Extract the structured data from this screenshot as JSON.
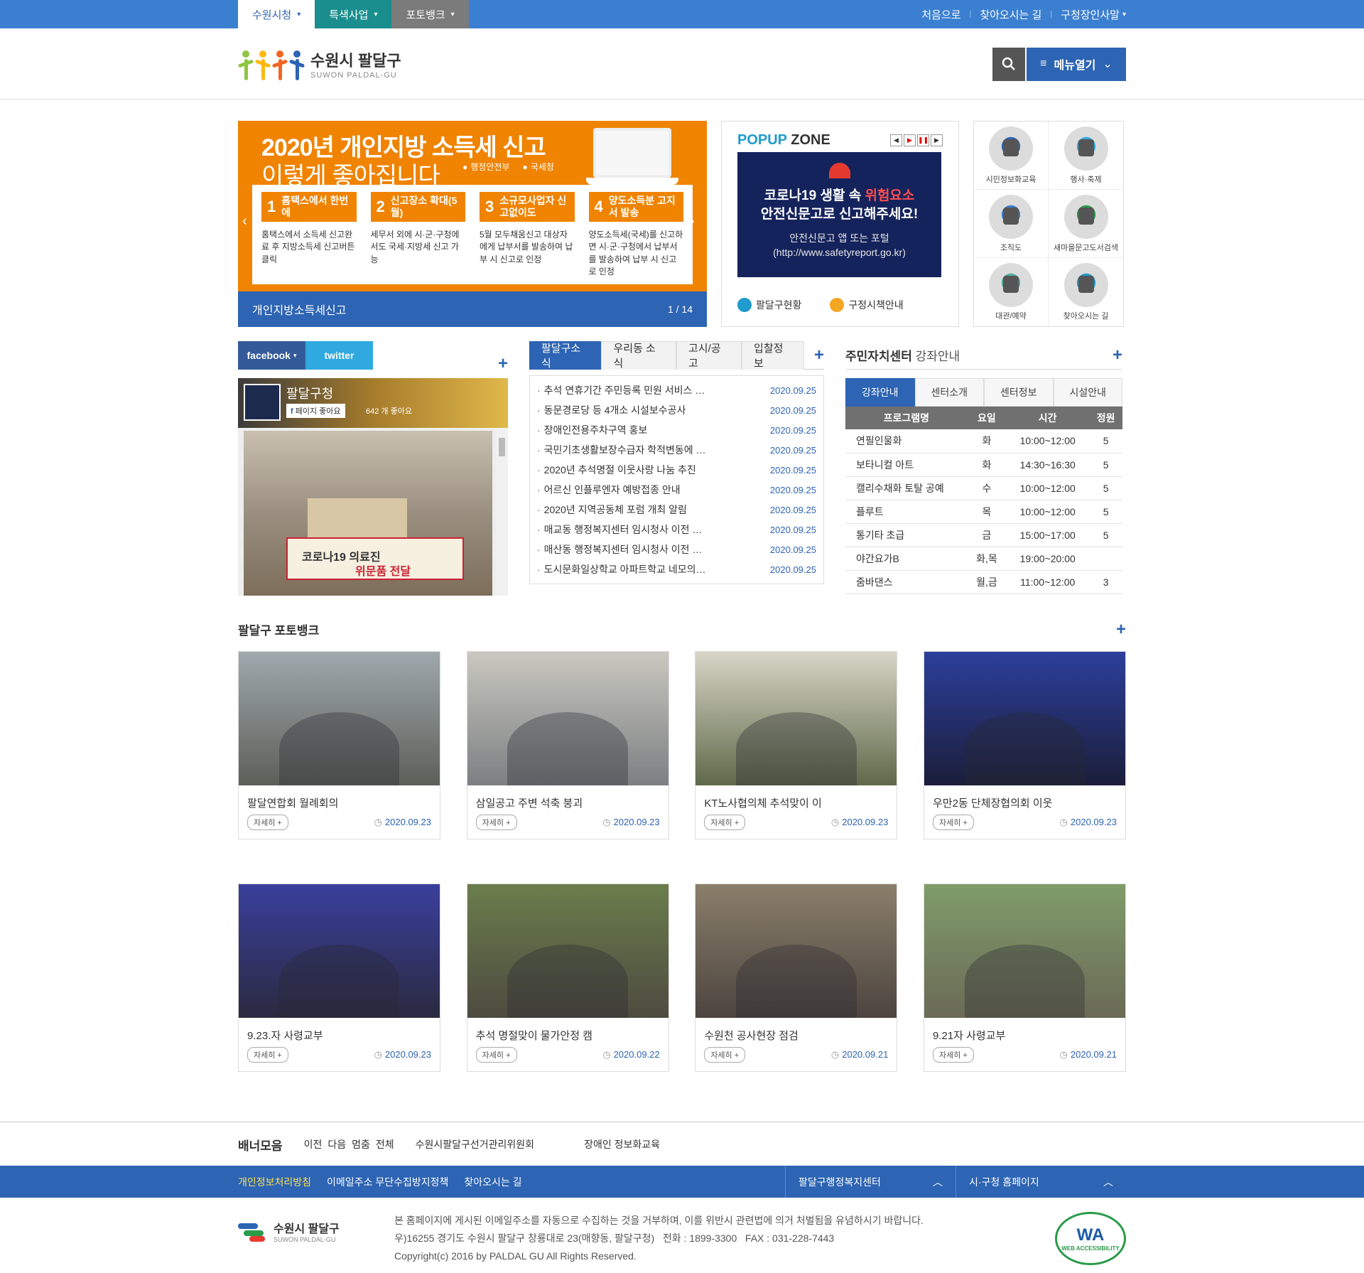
{
  "topbar": {
    "tabs": [
      {
        "label": "수원시청"
      },
      {
        "label": "특색사업"
      },
      {
        "label": "포토뱅크"
      }
    ],
    "links": [
      "처음으로",
      "찾아오시는 길",
      "구청장인사말"
    ]
  },
  "header": {
    "logo_ko": "수원시 팔달구",
    "logo_en": "SUWON PALDAL-GU",
    "menu_label": "메뉴열기"
  },
  "banner": {
    "title1": "2020년 개인지방 소득세 신고",
    "title2": "이렇게 좋아집니다",
    "org1": "행정안전부",
    "org2": "국세청",
    "steps": [
      {
        "num": "1",
        "label": "홈택스에서 한번에",
        "desc": "홈택스에서 소득세 신고완료 후 지방소득세 신고버튼 클릭"
      },
      {
        "num": "2",
        "label": "신고장소 확대(5월)",
        "desc": "세무서 외에 시·군·구청에서도 국세·지방세 신고 가능"
      },
      {
        "num": "3",
        "label": "소규모사업자 신고없이도",
        "desc": "5월 모두채움신고 대상자에게 납부서를 발송하여 납부 시 신고로 인정"
      },
      {
        "num": "4",
        "label": "양도소득분 고지서 발송",
        "desc": "양도소득세(국세)를 신고하면 시·군·구청에서 납부서를 발송하여 납부 시 신고로 인정"
      }
    ],
    "caption": "개인지방소득세신고",
    "counter": "1 / 14"
  },
  "popup": {
    "title_a": "POPUP",
    "title_b": " ZONE",
    "img_line1a": "코로나19 생활 속 ",
    "img_line1b": "위험요소",
    "img_line2": "안전신문고로 신고해주세요!",
    "img_line3": "안전신문고 앱 또는 포털",
    "img_line4": "(http://www.safetyreport.go.kr)",
    "link1": "팔달구현황",
    "link2": "구정시책안내"
  },
  "quick": [
    {
      "label": "시민정보화교육",
      "color": "#2d64b3"
    },
    {
      "label": "행사·축제",
      "color": "#2fa9e0"
    },
    {
      "label": "조직도",
      "color": "#3b7fd0"
    },
    {
      "label": "새마을문고도서검색",
      "color": "#2a9b4a"
    },
    {
      "label": "대관/예약",
      "color": "#4caf9e"
    },
    {
      "label": "찾아오시는 길",
      "color": "#1f9bcd"
    }
  ],
  "sns": {
    "tab_facebook": "facebook",
    "tab_twitter": "twitter",
    "page_name": "팔달구청",
    "like_btn": "페이지 좋아요",
    "like_count": "642 개 좋아요",
    "photo_text1": "코로나19 의료진",
    "photo_text2": "위문품 전달"
  },
  "news": {
    "tabs": [
      "팔달구소식",
      "우리동 소식",
      "고시/공고",
      "입찰정보"
    ],
    "items": [
      {
        "title": "추석 연휴기간 주민등록 민원 서비스 …",
        "date": "2020.09.25"
      },
      {
        "title": "동문경로당 등 4개소 시설보수공사",
        "date": "2020.09.25"
      },
      {
        "title": "장애인전용주차구역 홍보",
        "date": "2020.09.25"
      },
      {
        "title": "국민기초생활보장수급자 학적변동에 …",
        "date": "2020.09.25"
      },
      {
        "title": "2020년 추석명절 이웃사랑 나눔 추진",
        "date": "2020.09.25"
      },
      {
        "title": "어르신 인플루엔자 예방접종 안내",
        "date": "2020.09.25"
      },
      {
        "title": "2020년 지역공동체 포럼 개최 알림",
        "date": "2020.09.25"
      },
      {
        "title": "매교동 행정복지센터 임시청사 이전 …",
        "date": "2020.09.25"
      },
      {
        "title": "매산동 행정복지센터 임시청사 이전 …",
        "date": "2020.09.25"
      },
      {
        "title": "도시문화일상학교 아파트학교 네모의…",
        "date": "2020.09.25"
      }
    ]
  },
  "center": {
    "title_a": "주민자치센터",
    "title_b": " 강좌안내",
    "tabs": [
      "강좌안내",
      "센터소개",
      "센터정보",
      "시설안내"
    ],
    "headers": [
      "프로그램명",
      "요일",
      "시간",
      "정원"
    ],
    "rows": [
      [
        "연필인물화",
        "화",
        "10:00~12:00",
        "5"
      ],
      [
        "보타니컬 아트",
        "화",
        "14:30~16:30",
        "5"
      ],
      [
        "캘리수채화 토탈 공예",
        "수",
        "10:00~12:00",
        "5"
      ],
      [
        "플루트",
        "목",
        "10:00~12:00",
        "5"
      ],
      [
        "통기타 초급",
        "금",
        "15:00~17:00",
        "5"
      ],
      [
        "야간요가B",
        "화,목",
        "19:00~20:00",
        ""
      ],
      [
        "줌바댄스",
        "월,금",
        "11:00~12:00",
        "3"
      ]
    ]
  },
  "photobank": {
    "title": "팔달구 포토뱅크",
    "more_label": "자세히 +",
    "items": [
      {
        "title": "팔달연합회 월례회의",
        "date": "2020.09.23",
        "color1": "#9fa8ad",
        "color2": "#5d5f58"
      },
      {
        "title": "삼일공고 주변 석축 붕괴",
        "date": "2020.09.23",
        "color1": "#c9c8c0",
        "color2": "#7c7f82"
      },
      {
        "title": "KT노사협의체 추석맞이 이",
        "date": "2020.09.23",
        "color1": "#d8d5c6",
        "color2": "#5f6a4a"
      },
      {
        "title": "우만2동 단체장협의회 이웃",
        "date": "2020.09.23",
        "color1": "#2c3f9b",
        "color2": "#1b1e3a"
      },
      {
        "title": "9.23.자 사령교부",
        "date": "2020.09.23",
        "color1": "#3a3f9c",
        "color2": "#2a2a40"
      },
      {
        "title": "추석 명절맞이 물가안정 캠",
        "date": "2020.09.22",
        "color1": "#6b7d4c",
        "color2": "#4d4b40"
      },
      {
        "title": "수원천 공사현장 점검",
        "date": "2020.09.21",
        "color1": "#8a7f6a",
        "color2": "#4d4440"
      },
      {
        "title": "9.21자 사령교부",
        "date": "2020.09.21",
        "color1": "#7f9c6a",
        "color2": "#6b6a56"
      }
    ]
  },
  "bannerbar": {
    "title": "배너모음",
    "controls": [
      "이전",
      "다음",
      "멈춤",
      "전체"
    ],
    "items": [
      "수원시팔달구선거관리위원회",
      "장애인 정보화교육"
    ]
  },
  "footnav": {
    "links": [
      "개인정보처리방침",
      "이메일주소 무단수집방지정책",
      "찾아오시는 길"
    ],
    "select1": "팔달구행정복지센터",
    "select2": "시·구청 홈페이지"
  },
  "footer": {
    "logo_ko": "수원시 팔달구",
    "logo_en": "SUWON PALDAL-GU",
    "line1": "본 홈페이지에 게시된 이메일주소를 자동으로 수집하는 것을 거부하며, 이를 위반시 관련법에 의거 처벌됨을 유념하시기 바랍니다.",
    "line2": "우)16255 경기도 수원시 팔달구 창룡대로 23(매향동, 팔달구청)   전화 : 1899-3300   FAX : 031-228-7443",
    "line3": "Copyright(c) 2016 by PALDAL GU All Rights Reserved.",
    "badge_top": "WA",
    "badge_bottom": "WEB ACCESSIBILITY"
  }
}
